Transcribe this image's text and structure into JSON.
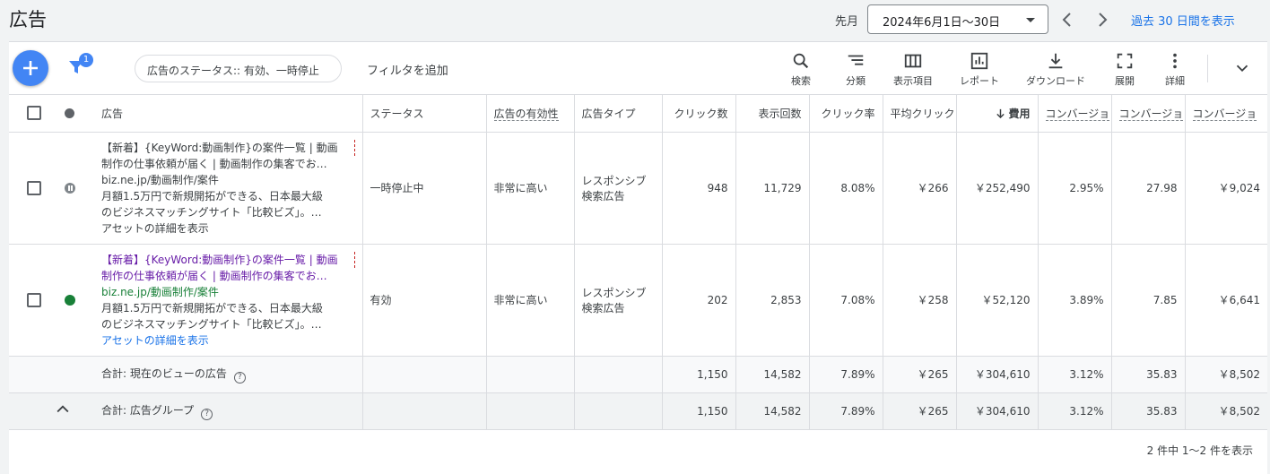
{
  "header": {
    "title": "広告",
    "period_label": "先月",
    "date_range": "2024年6月1日～30日",
    "last30_link": "過去 30 日間を表示"
  },
  "toolbar": {
    "filter_badge": "1",
    "filter_chip": "広告のステータス:: 有効、一時停止",
    "add_filter": "フィルタを追加",
    "tools": [
      {
        "label": "検索",
        "icon": "search-icon"
      },
      {
        "label": "分類",
        "icon": "segment-icon"
      },
      {
        "label": "表示項目",
        "icon": "columns-icon"
      },
      {
        "label": "レポート",
        "icon": "report-icon"
      },
      {
        "label": "ダウンロード",
        "icon": "download-icon"
      },
      {
        "label": "展開",
        "icon": "fullscreen-icon"
      },
      {
        "label": "詳細",
        "icon": "more-vert-icon"
      }
    ]
  },
  "table": {
    "headers": {
      "ad": "広告",
      "status": "ステータス",
      "ad_strength": "広告の有効性",
      "ad_type": "広告タイプ",
      "clicks": "クリック数",
      "impressions": "表示回数",
      "ctr": "クリック率",
      "avg_cpc": "平均クリック",
      "cost": "費用",
      "conv_rate": "コンバージョ",
      "conversions": "コンバージョ",
      "cost_per_conv": "コンバージョ"
    },
    "rows": [
      {
        "status_icon": "paused",
        "title": "【新着】{KeyWord:動画制作}の案件一覧 | 動画制作の仕事依頼が届く | 動画制作の集客でお…",
        "title_line1": "【新着】{KeyWord:動画制作}の案件一覧 | 動画",
        "title_line2": "制作の仕事依頼が届く | 動画制作の集客でお…",
        "url": "biz.ne.jp/動画制作/案件",
        "desc_line1": "月額1.5万円で新規開拓ができる、日本最大級",
        "desc_line2": "のビジネスマッチングサイト「比較ビズ」。…",
        "asset_link": "アセットの詳細を表示",
        "status": "一時停止中",
        "ad_strength": "非常に高い",
        "ad_type_line1": "レスポンシブ",
        "ad_type_line2": "検索広告",
        "clicks": "948",
        "impressions": "11,729",
        "ctr": "8.08%",
        "avg_cpc": "￥266",
        "cost": "￥252,490",
        "conv_rate": "2.95%",
        "conversions": "27.98",
        "cost_per_conv": "￥9,024"
      },
      {
        "status_icon": "active",
        "title_line1": "【新着】{KeyWord:動画制作}の案件一覧 | 動画",
        "title_line2": "制作の仕事依頼が届く | 動画制作の集客でお…",
        "url": "biz.ne.jp/動画制作/案件",
        "desc_line1": "月額1.5万円で新規開拓ができる、日本最大級",
        "desc_line2": "のビジネスマッチングサイト「比較ビズ」。…",
        "asset_link": "アセットの詳細を表示",
        "status": "有効",
        "ad_strength": "非常に高い",
        "ad_type_line1": "レスポンシブ",
        "ad_type_line2": "検索広告",
        "clicks": "202",
        "impressions": "2,853",
        "ctr": "7.08%",
        "avg_cpc": "￥258",
        "cost": "￥52,120",
        "conv_rate": "3.89%",
        "conversions": "7.85",
        "cost_per_conv": "￥6,641"
      }
    ],
    "totals": [
      {
        "label": "合計: 現在のビューの広告",
        "clicks": "1,150",
        "impressions": "14,582",
        "ctr": "7.89%",
        "avg_cpc": "￥265",
        "cost": "￥304,610",
        "conv_rate": "3.12%",
        "conversions": "35.83",
        "cost_per_conv": "￥8,502"
      },
      {
        "label": "合計: 広告グループ",
        "clicks": "1,150",
        "impressions": "14,582",
        "ctr": "7.89%",
        "avg_cpc": "￥265",
        "cost": "￥304,610",
        "conv_rate": "3.12%",
        "conversions": "35.83",
        "cost_per_conv": "￥8,502"
      }
    ],
    "pagination": "2 件中 1～2 件を表示"
  },
  "colors": {
    "accent": "#4285f4",
    "link": "#1a73e8",
    "active_status": "#188038",
    "visited_title": "#681da8"
  }
}
